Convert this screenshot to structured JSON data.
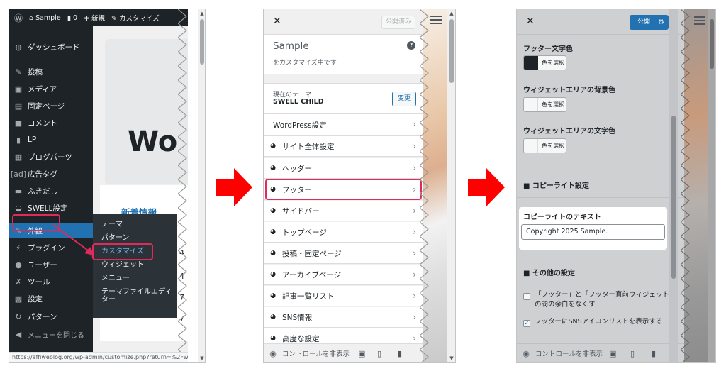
{
  "accent_color": "#e12a5c",
  "admin_bar": {
    "site_name": "Sample",
    "comments_count": "0",
    "new_label": "新規",
    "customize_label": "カスタマイズ"
  },
  "admin_menu": {
    "items": [
      {
        "icon": "dashboard-icon",
        "glyph": "◍",
        "label": "ダッシュボード"
      },
      {
        "icon": "pin-icon",
        "glyph": "✎",
        "label": "投稿"
      },
      {
        "icon": "media-icon",
        "glyph": "▣",
        "label": "メディア"
      },
      {
        "icon": "page-icon",
        "glyph": "▤",
        "label": "固定ページ"
      },
      {
        "icon": "comment-icon",
        "glyph": "■",
        "label": "コメント"
      },
      {
        "icon": "lp-icon",
        "glyph": "▮",
        "label": "LP"
      },
      {
        "icon": "blog-parts-icon",
        "glyph": "▦",
        "label": "ブログパーツ"
      },
      {
        "icon": "ad-icon",
        "glyph": "[ad]",
        "label": "広告タグ"
      },
      {
        "icon": "balloon-icon",
        "glyph": "▬",
        "label": "ふきだし"
      },
      {
        "icon": "swell-icon",
        "glyph": "◒",
        "label": "SWELL設定"
      },
      {
        "icon": "appearance-icon",
        "glyph": "✎",
        "label": "外観"
      },
      {
        "icon": "plugin-icon",
        "glyph": "⚡",
        "label": "プラグイン"
      },
      {
        "icon": "user-icon",
        "glyph": "●",
        "label": "ユーザー"
      },
      {
        "icon": "tool-icon",
        "glyph": "✗",
        "label": "ツール"
      },
      {
        "icon": "settings-icon",
        "glyph": "▩",
        "label": "設定"
      },
      {
        "icon": "pattern-icon",
        "glyph": "↻",
        "label": "パターン"
      }
    ],
    "collapse_label": "メニューを閉じる",
    "flyout": [
      "テーマ",
      "パターン",
      "カスタマイズ",
      "ウィジェット",
      "メニュー",
      "テーマファイルエディター"
    ]
  },
  "dashboard": {
    "welcome_big": "Wo",
    "news_title": "新着情報",
    "digits": [
      "4",
      "4",
      "7",
      "7"
    ]
  },
  "status_url": "https://affiweblog.org/wp-admin/customize.php?return=%2Fw",
  "customizer": {
    "close": "✕",
    "published_label": "公開済み",
    "site_title": "Sample",
    "customizing_label": "をカスタマイズ中です",
    "help": "?",
    "current_theme_label": "現在のテーマ",
    "theme_name": "SWELL CHILD",
    "change_label": "変更",
    "sections": [
      "WordPress設定",
      "サイト全体設定",
      "ヘッダー",
      "フッター",
      "サイドバー",
      "トップページ",
      "投稿・固定ページ",
      "アーカイブページ",
      "記事一覧リスト",
      "SNS情報",
      "高度な設定"
    ],
    "hide_controls_label": "コントロールを非表示"
  },
  "footer_settings": {
    "publish_label": "公開",
    "footer_text_color_label": "フッター文字色",
    "widget_bg_color_label": "ウィジェットエリアの背景色",
    "widget_text_color_label": "ウィジェットエリアの文字色",
    "select_color_label": "色を選択",
    "copyright_heading": "■ コピーライト設定",
    "copyright_text_label": "コピーライトのテキスト",
    "copyright_value": "Copyright 2025 Sample.",
    "other_heading": "■ その他の設定",
    "option1": "「フッター」と「フッター直前ウィジェット」の間の余白をなくす",
    "option2": "フッターにSNSアイコンリストを表示する",
    "option1_checked": false,
    "option2_checked": true,
    "hide_controls_label": "コントロールを非表示"
  }
}
